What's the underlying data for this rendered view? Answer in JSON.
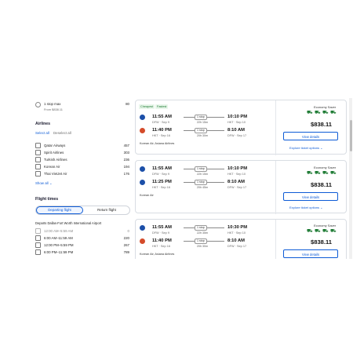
{
  "sidebar": {
    "stops": {
      "label": "1 stop max",
      "from": "From $838.11",
      "count": "80"
    },
    "airlines": {
      "title": "Airlines",
      "select_all": "Select all",
      "deselect_all": "Deselect all",
      "items": [
        {
          "label": "Qatar Airways",
          "count": "457"
        },
        {
          "label": "Spirit Airlines",
          "count": "303"
        },
        {
          "label": "Turkish Airlines",
          "count": "236"
        },
        {
          "label": "Korean Air",
          "count": "194"
        },
        {
          "label": "Thai VietJet Air",
          "count": "176"
        }
      ],
      "show_all": "Show all"
    },
    "flight_times": {
      "title": "Flight times",
      "tab_departing": "Departing flight",
      "tab_return": "Return flight",
      "departs_label": "Departs Dallas-Fort Worth International Airport",
      "items": [
        {
          "label": "12:00 AM–5:59 AM",
          "count": "0"
        },
        {
          "label": "6:00 AM–11:59 AM",
          "count": "220"
        },
        {
          "label": "12:00 PM–5:59 PM",
          "count": "267"
        },
        {
          "label": "6:00 PM–11:59 PM",
          "count": "789"
        }
      ]
    }
  },
  "results": [
    {
      "tags": [
        "Cheapest",
        "Fastest"
      ],
      "outbound": {
        "dep_time": "11:55 AM",
        "dep_sub": "DFW · Sep 9",
        "stop": "1 stop",
        "duration": "22h 15m",
        "arr_time": "10:10 PM",
        "arr_sub": "HKT · Sep 10"
      },
      "return": {
        "dep_time": "11:40 PM",
        "dep_sub": "HKT · Sep 16",
        "stop": "1 stop",
        "duration": "20h 30m",
        "arr_time": "8:10 AM",
        "arr_sub": "DFW · Sep 17"
      },
      "airline": "Korean Air, Asiana Airlines",
      "cabin": "Economy Saver",
      "price": "$838.11",
      "view": "View details",
      "options": "Explore ticket options"
    },
    {
      "tags": [],
      "outbound": {
        "dep_time": "11:55 AM",
        "dep_sub": "DFW · Sep 9",
        "stop": "1 stop",
        "duration": "22h 15m",
        "arr_time": "10:10 PM",
        "arr_sub": "HKT · Sep 10"
      },
      "return": {
        "dep_time": "11:25 PM",
        "dep_sub": "HKT · Sep 16",
        "stop": "1 stop",
        "duration": "20h 45m",
        "arr_time": "8:10 AM",
        "arr_sub": "DFW · Sep 17"
      },
      "airline": "Korean Air",
      "cabin": "Economy Saver",
      "price": "$838.11",
      "view": "View details",
      "options": "Explore ticket options"
    },
    {
      "tags": [],
      "outbound": {
        "dep_time": "11:55 AM",
        "dep_sub": "DFW · Sep 9",
        "stop": "1 stop",
        "duration": "22h 35m",
        "arr_time": "10:30 PM",
        "arr_sub": "HKT · Sep 10"
      },
      "return": {
        "dep_time": "11:40 PM",
        "dep_sub": "HKT · Sep 16",
        "stop": "1 stop",
        "duration": "20h 30m",
        "arr_time": "8:10 AM",
        "arr_sub": "DFW · Sep 17"
      },
      "airline": "Korean Air, Asiana Airlines",
      "cabin": "Economy Saver",
      "price": "$838.11",
      "view": "View details",
      "options": "Explore ticket options"
    }
  ],
  "colors": {
    "accent": "#0d5bd6",
    "tag_green": "#1e7b34"
  },
  "icons": [
    "korean-air-logo-icon",
    "asiana-logo-icon",
    "seat-icon",
    "bag-icon",
    "wifi-icon",
    "chevron-down-icon"
  ]
}
